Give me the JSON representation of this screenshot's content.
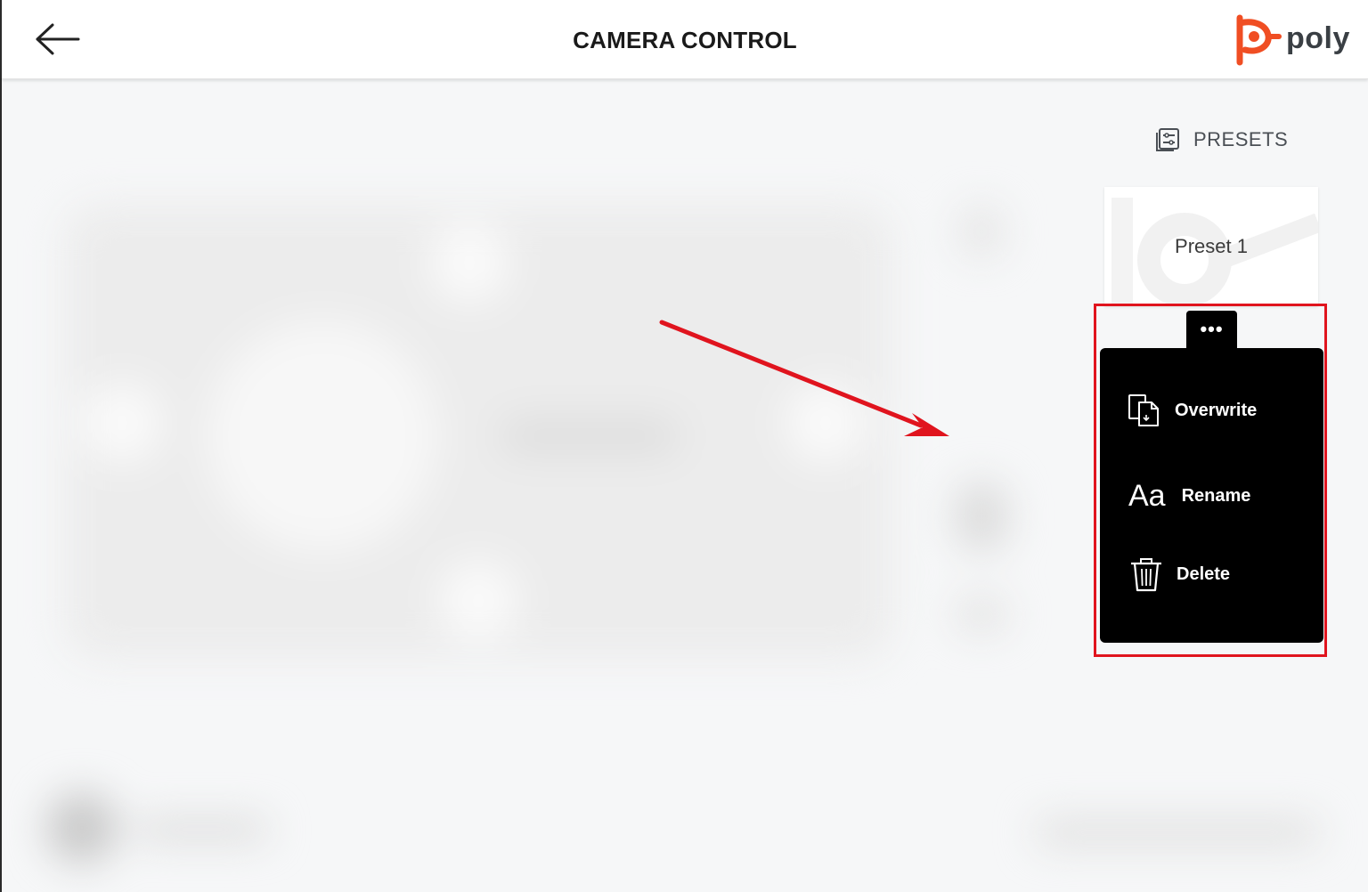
{
  "header": {
    "title": "CAMERA CONTROL",
    "logo_text": "poly",
    "back_icon": "arrow-left-icon",
    "brand_color": "#f04e23"
  },
  "presets": {
    "label": "PRESETS",
    "icon": "presets-list-icon",
    "items": [
      {
        "name": "Preset 1"
      }
    ]
  },
  "context_menu": {
    "trigger_label": "•••",
    "items": [
      {
        "label": "Overwrite",
        "icon": "overwrite-icon"
      },
      {
        "label": "Rename",
        "icon": "rename-icon",
        "icon_text": "Aa"
      },
      {
        "label": "Delete",
        "icon": "trash-icon"
      }
    ]
  },
  "annotation": {
    "highlight_color": "#e0141e"
  }
}
